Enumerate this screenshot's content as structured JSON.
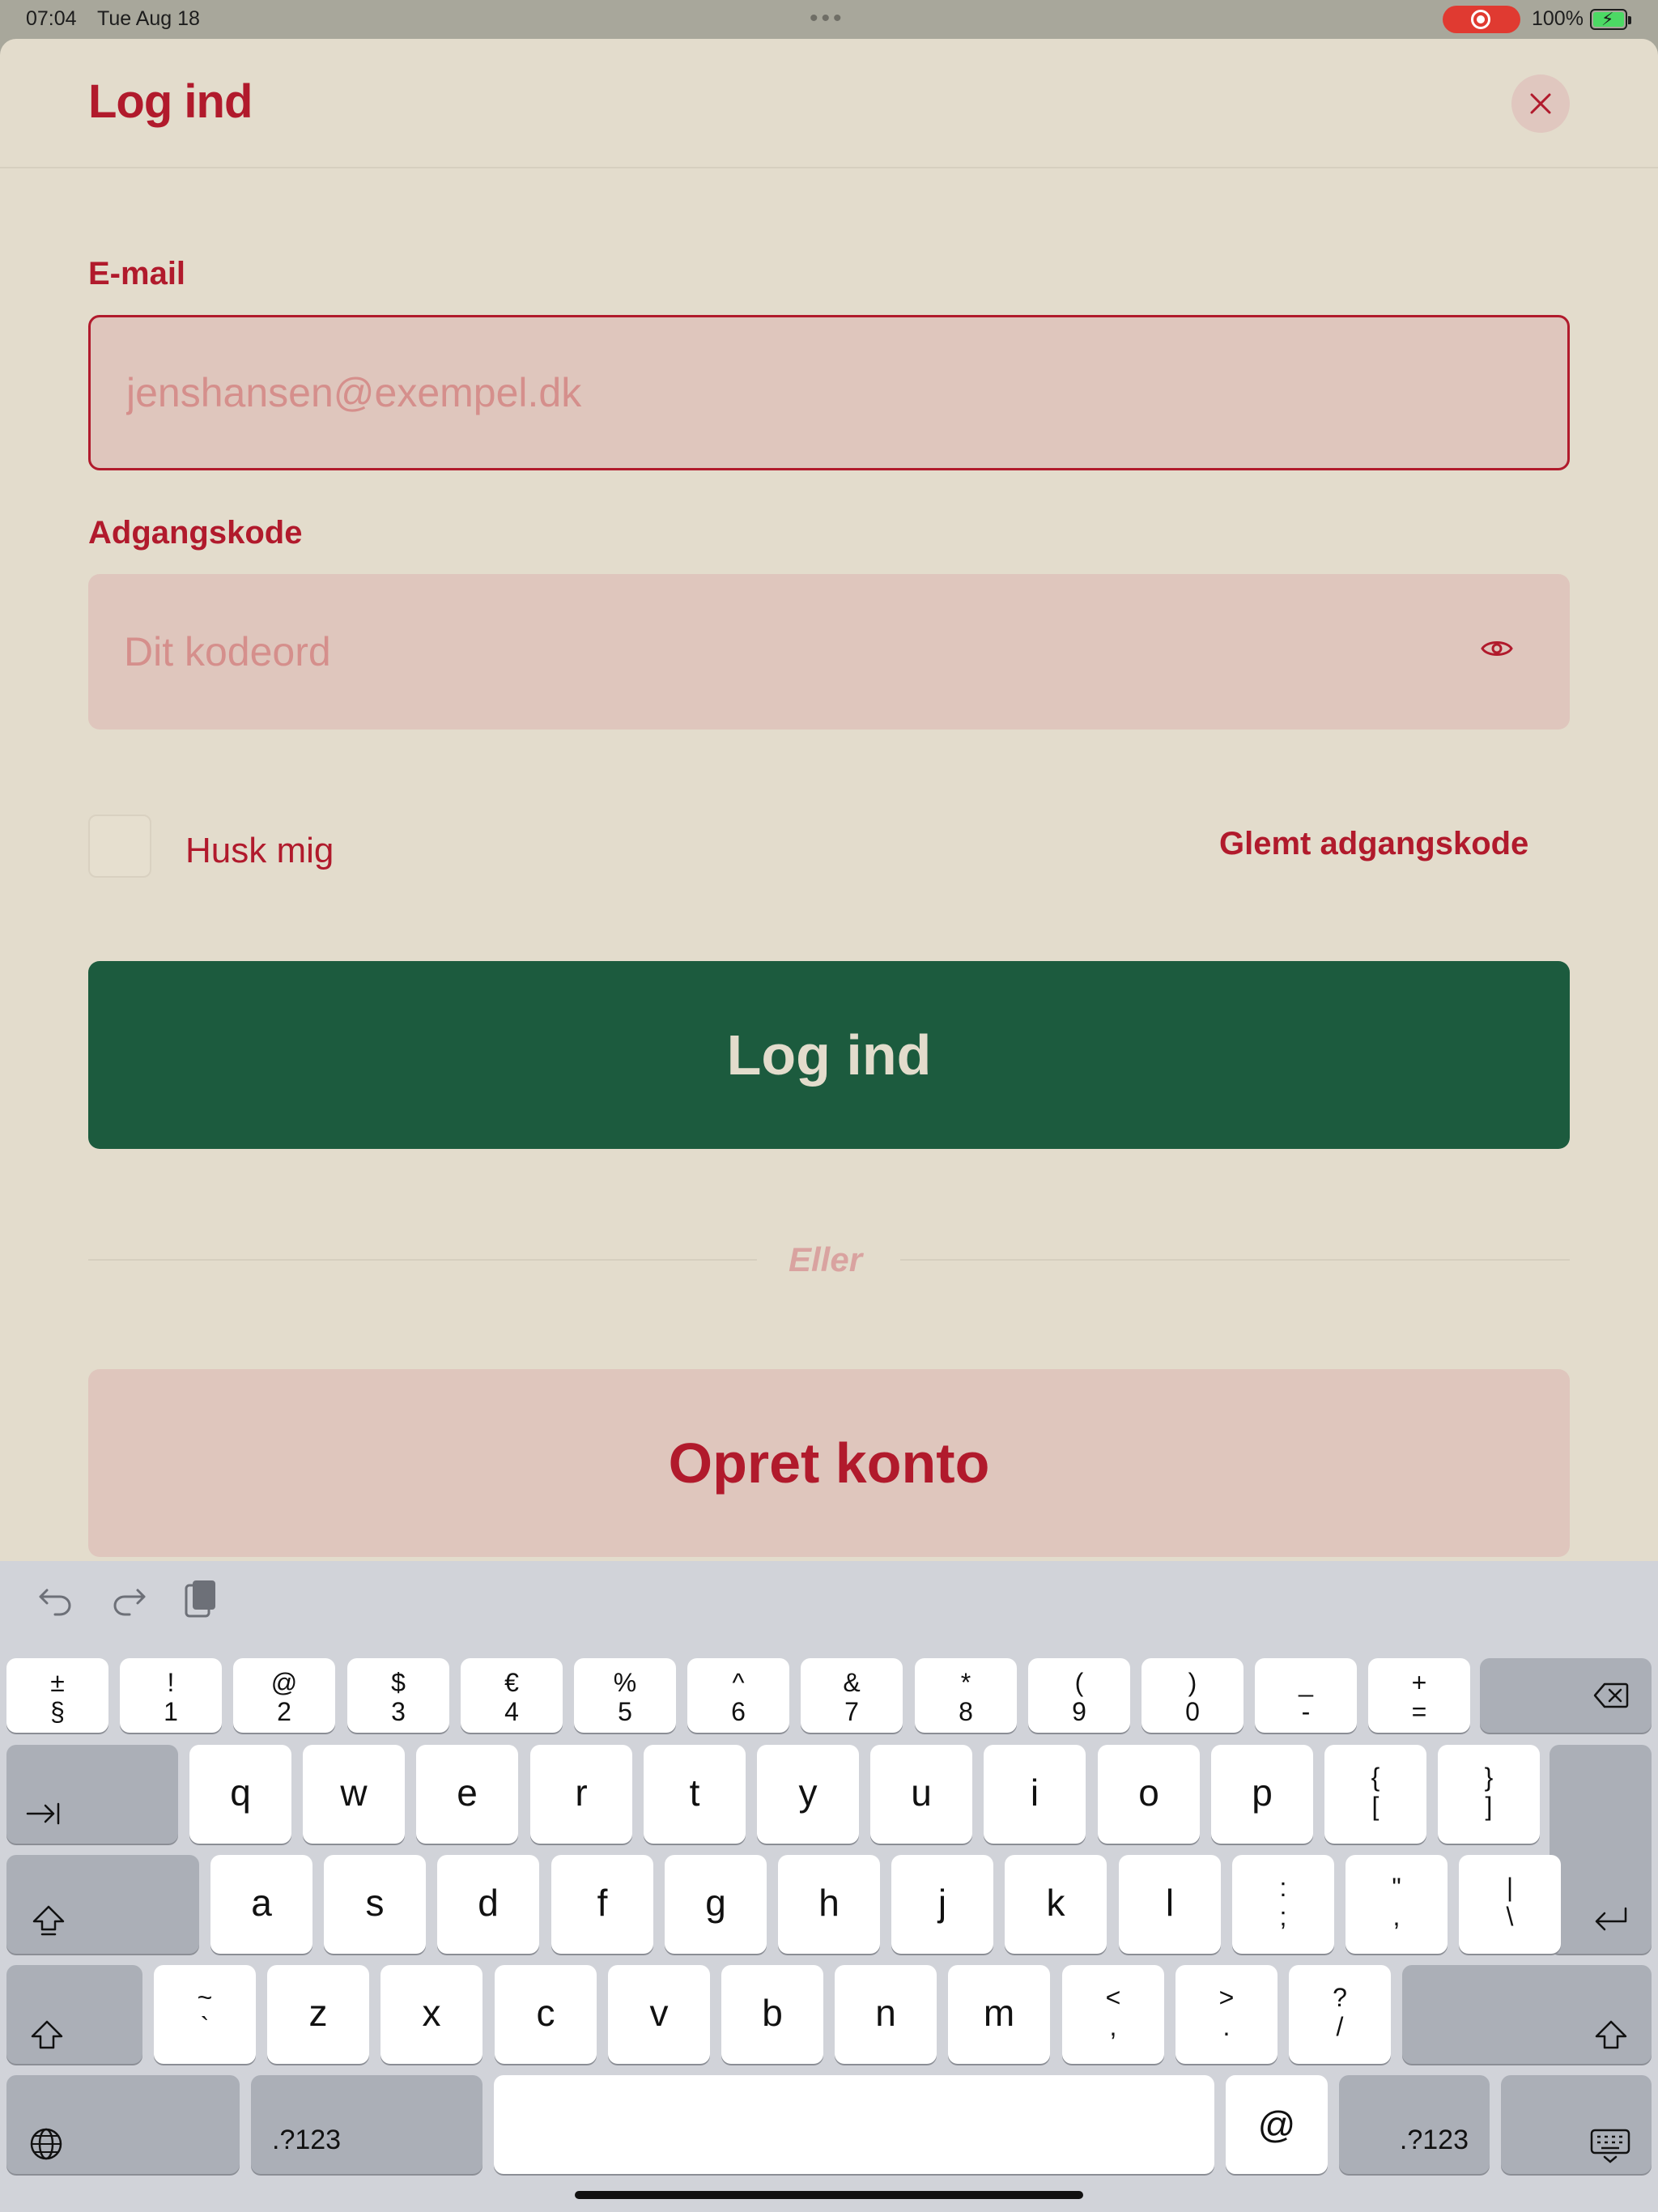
{
  "status_bar": {
    "time": "07:04",
    "date": "Tue Aug 18",
    "battery": "100%"
  },
  "sheet": {
    "title": "Log ind",
    "email": {
      "label": "E-mail",
      "placeholder": "jenshansen@exempel.dk",
      "value": ""
    },
    "password": {
      "label": "Adgangskode",
      "placeholder": "Dit kodeord",
      "value": ""
    },
    "remember_label": "Husk mig",
    "forgot_label": "Glemt adgangskode",
    "login_label": "Log ind",
    "divider_label": "Eller",
    "create_label": "Opret konto"
  },
  "colors": {
    "accent": "#b11a2c",
    "primary_button": "#1c5b3e",
    "background": "#e3dccc",
    "input_background": "#dfc6bd"
  },
  "keyboard": {
    "number_row": [
      {
        "top": "±",
        "bot": "§"
      },
      {
        "top": "!",
        "bot": "1"
      },
      {
        "top": "@",
        "bot": "2"
      },
      {
        "top": "$",
        "bot": "3"
      },
      {
        "top": "€",
        "bot": "4"
      },
      {
        "top": "%",
        "bot": "5"
      },
      {
        "top": "^",
        "bot": "6"
      },
      {
        "top": "&",
        "bot": "7"
      },
      {
        "top": "*",
        "bot": "8"
      },
      {
        "top": "(",
        "bot": "9"
      },
      {
        "top": ")",
        "bot": "0"
      },
      {
        "top": "_",
        "bot": "-"
      },
      {
        "top": "+",
        "bot": "="
      }
    ],
    "row_q": [
      "q",
      "w",
      "e",
      "r",
      "t",
      "y",
      "u",
      "i",
      "o",
      "p"
    ],
    "row_q_extra": [
      {
        "top": "{",
        "bot": "["
      },
      {
        "top": "}",
        "bot": "]"
      }
    ],
    "row_a": [
      "a",
      "s",
      "d",
      "f",
      "g",
      "h",
      "j",
      "k",
      "l"
    ],
    "row_a_extra": [
      {
        "top": ":",
        "bot": ";"
      },
      {
        "top": "\"",
        "bot": ","
      },
      {
        "top": "|",
        "bot": "\\"
      }
    ],
    "row_z_first": {
      "top": "~",
      "bot": "`"
    },
    "row_z": [
      "z",
      "x",
      "c",
      "v",
      "b",
      "n",
      "m"
    ],
    "row_z_extra": [
      {
        "top": "<",
        "bot": ","
      },
      {
        "top": ">",
        "bot": "."
      },
      {
        "top": "?",
        "bot": "/"
      }
    ],
    "numbers_label": ".?123",
    "at_label": "@"
  }
}
